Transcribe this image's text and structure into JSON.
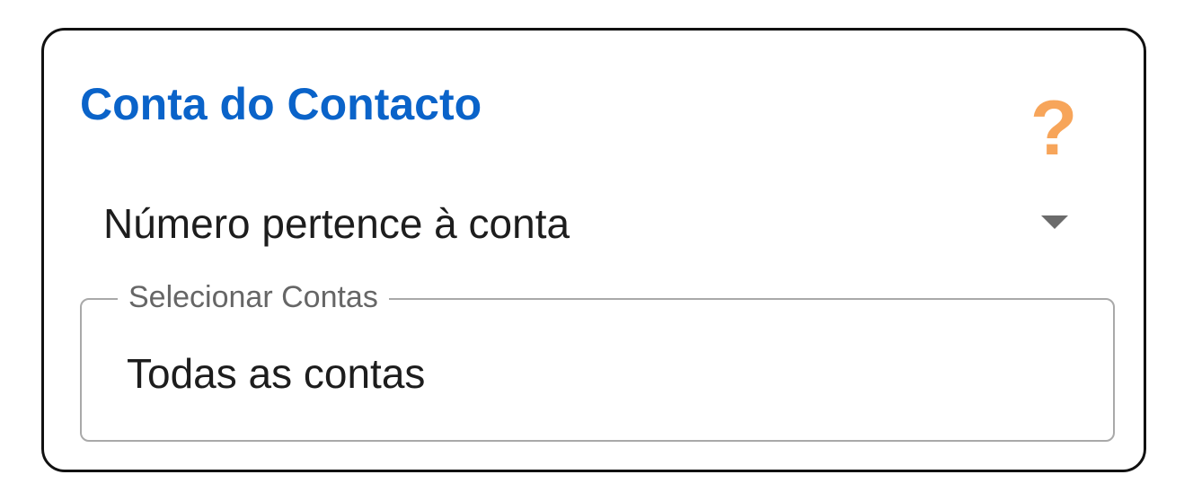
{
  "card": {
    "title": "Conta do Contacto",
    "help_icon": "?",
    "help_icon_name": "question-mark-icon",
    "title_color": "#0a63c9",
    "help_icon_color": "#f7a55a"
  },
  "condition_select": {
    "selected": "Número pertence à conta",
    "arrow_icon": "dropdown-arrow-icon"
  },
  "accounts_field": {
    "label": "Selecionar Contas",
    "value": "Todas as contas"
  }
}
